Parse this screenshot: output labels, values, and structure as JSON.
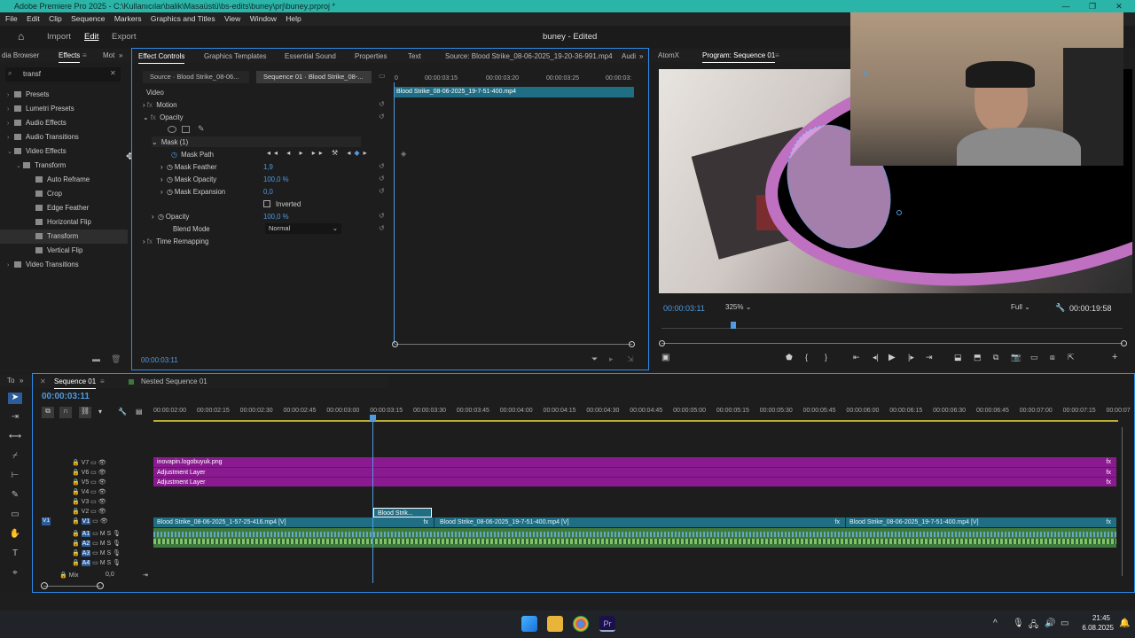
{
  "window": {
    "title": "Adobe Premiere Pro 2025 - C:\\Kullanıcılar\\balik\\Masaüstü\\bs-edits\\buney\\prj\\buney.prproj *"
  },
  "menu": [
    "File",
    "Edit",
    "Clip",
    "Sequence",
    "Markers",
    "Graphics and Titles",
    "View",
    "Window",
    "Help"
  ],
  "header": {
    "import": "Import",
    "edit": "Edit",
    "export": "Export",
    "project": "buney - Edited"
  },
  "left_tabs": [
    "dia Browser",
    "Effects",
    "Mot"
  ],
  "search": {
    "value": "transf"
  },
  "effects_tree": [
    {
      "label": "Presets",
      "level": 0
    },
    {
      "label": "Lumetri Presets",
      "level": 0
    },
    {
      "label": "Audio Effects",
      "level": 0
    },
    {
      "label": "Audio Transitions",
      "level": 0
    },
    {
      "label": "Video Effects",
      "level": 0
    },
    {
      "label": "Transform",
      "level": 1
    },
    {
      "label": "Auto Reframe",
      "level": 2
    },
    {
      "label": "Crop",
      "level": 2
    },
    {
      "label": "Edge Feather",
      "level": 2
    },
    {
      "label": "Horizontal Flip",
      "level": 2
    },
    {
      "label": "Transform",
      "level": 2
    },
    {
      "label": "Vertical Flip",
      "level": 2
    },
    {
      "label": "Video Transitions",
      "level": 0
    }
  ],
  "center_tabs": [
    "Effect Controls",
    "Graphics Templates",
    "Essential Sound",
    "Properties",
    "Text",
    "Source: Blood Strike_08-06-2025_19-20-36-991.mp4",
    "Audi"
  ],
  "ec": {
    "source_tab": "Source · Blood Strike_08-06...",
    "seq_tab": "Sequence 01 · Blood Strike_08-...",
    "ruler": [
      "0",
      "00:00:03:15",
      "00:00:03:20",
      "00:00:03:25",
      "00:00:03:"
    ],
    "clip_name": "Blood Strike_08-06-2025_19-7-51-400.mp4",
    "video": "Video",
    "motion": "Motion",
    "opacity": "Opacity",
    "mask": "Mask (1)",
    "mask_path": "Mask Path",
    "mask_feather": "Mask Feather",
    "mask_feather_v": "1,9",
    "mask_opacity": "Mask Opacity",
    "mask_opacity_v": "100,0 %",
    "mask_expansion": "Mask Expansion",
    "mask_expansion_v": "0,0",
    "inverted": "Inverted",
    "opacity2": "Opacity",
    "opacity2_v": "100,0 %",
    "blend": "Blend Mode",
    "blend_v": "Normal",
    "time_remap": "Time Remapping",
    "timecode": "00:00:03:11"
  },
  "program": {
    "tabs": [
      "AtomX",
      "Program: Sequence 01"
    ],
    "timecode": "00:00:03:11",
    "zoom": "325%",
    "quality": "Full",
    "duration": "00:00:19:58"
  },
  "timeline": {
    "left_tabs": [
      "To"
    ],
    "tabs": [
      "Sequence 01",
      "Nested Sequence 01"
    ],
    "timecode": "00:00:03:11",
    "ruler": [
      "00:00:02:00",
      "00:00:02:15",
      "00:00:02:30",
      "00:00:02:45",
      "00:00:03:00",
      "00:00:03:15",
      "00:00:03:30",
      "00:00:03:45",
      "00:00:04:00",
      "00:00:04:15",
      "00:00:04:30",
      "00:00:04:45",
      "00:00:05:00",
      "00:00:05:15",
      "00:00:05:30",
      "00:00:05:45",
      "00:00:06:00",
      "00:00:06:15",
      "00:00:06:30",
      "00:00:06:45",
      "00:00:07:00",
      "00:00:07:15",
      "00:00:07"
    ],
    "video_tracks": [
      "V7",
      "V6",
      "V5",
      "V4",
      "V3",
      "V2",
      "V1"
    ],
    "audio_tracks": [
      "A1",
      "A2",
      "A3",
      "A4"
    ],
    "v7_clip": "inovapin.logobuyuk.png",
    "v6_clip": "Adjustment Layer",
    "v5_clip": "Adjustment Layer",
    "v2_clip": "Blood Strik...",
    "v1_clips": [
      "Blood Strike_08-06-2025_1-57-25-416.mp4 [V]",
      "Blood Strike_08-06-2025_19-7-51-400.mp4 [V]",
      "Blood Strike_08-06-2025_19-7-51-400.mp4 [V]"
    ],
    "mix": "Mix",
    "mix_v": "0,0"
  },
  "taskbar": {
    "time": "21:45",
    "date": "6.08.2025"
  },
  "colors": {
    "accent": "#2d8ceb",
    "titlebar": "#2bb5a8",
    "purple_clip": "#8a1a8f",
    "video_clip": "#1f6e84",
    "audio_clip": "#2f6b35"
  }
}
